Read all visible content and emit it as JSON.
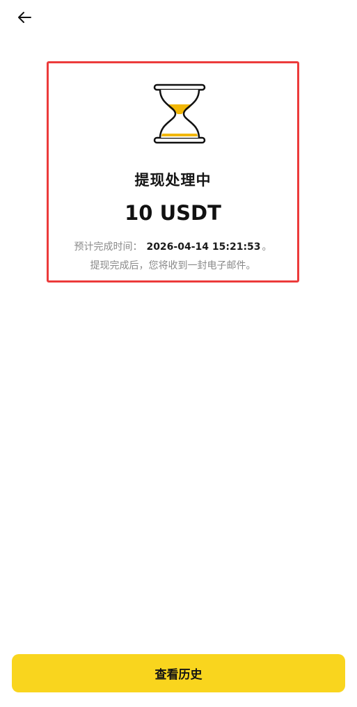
{
  "header": {
    "back_icon": "arrow-left-icon"
  },
  "status": {
    "icon": "hourglass-icon",
    "title": "提现处理中",
    "amount": "10 USDT",
    "eta_label": "预计完成时间：",
    "eta_time": "2026-04-14 15:21:53",
    "eta_suffix": "。",
    "notice": "提现完成后，您将收到一封电子邮件。"
  },
  "footer": {
    "history_button_label": "查看历史"
  },
  "colors": {
    "accent": "#f9d51e",
    "highlight_border": "#ec3b3b",
    "secondary_text": "#8a8a8a"
  }
}
